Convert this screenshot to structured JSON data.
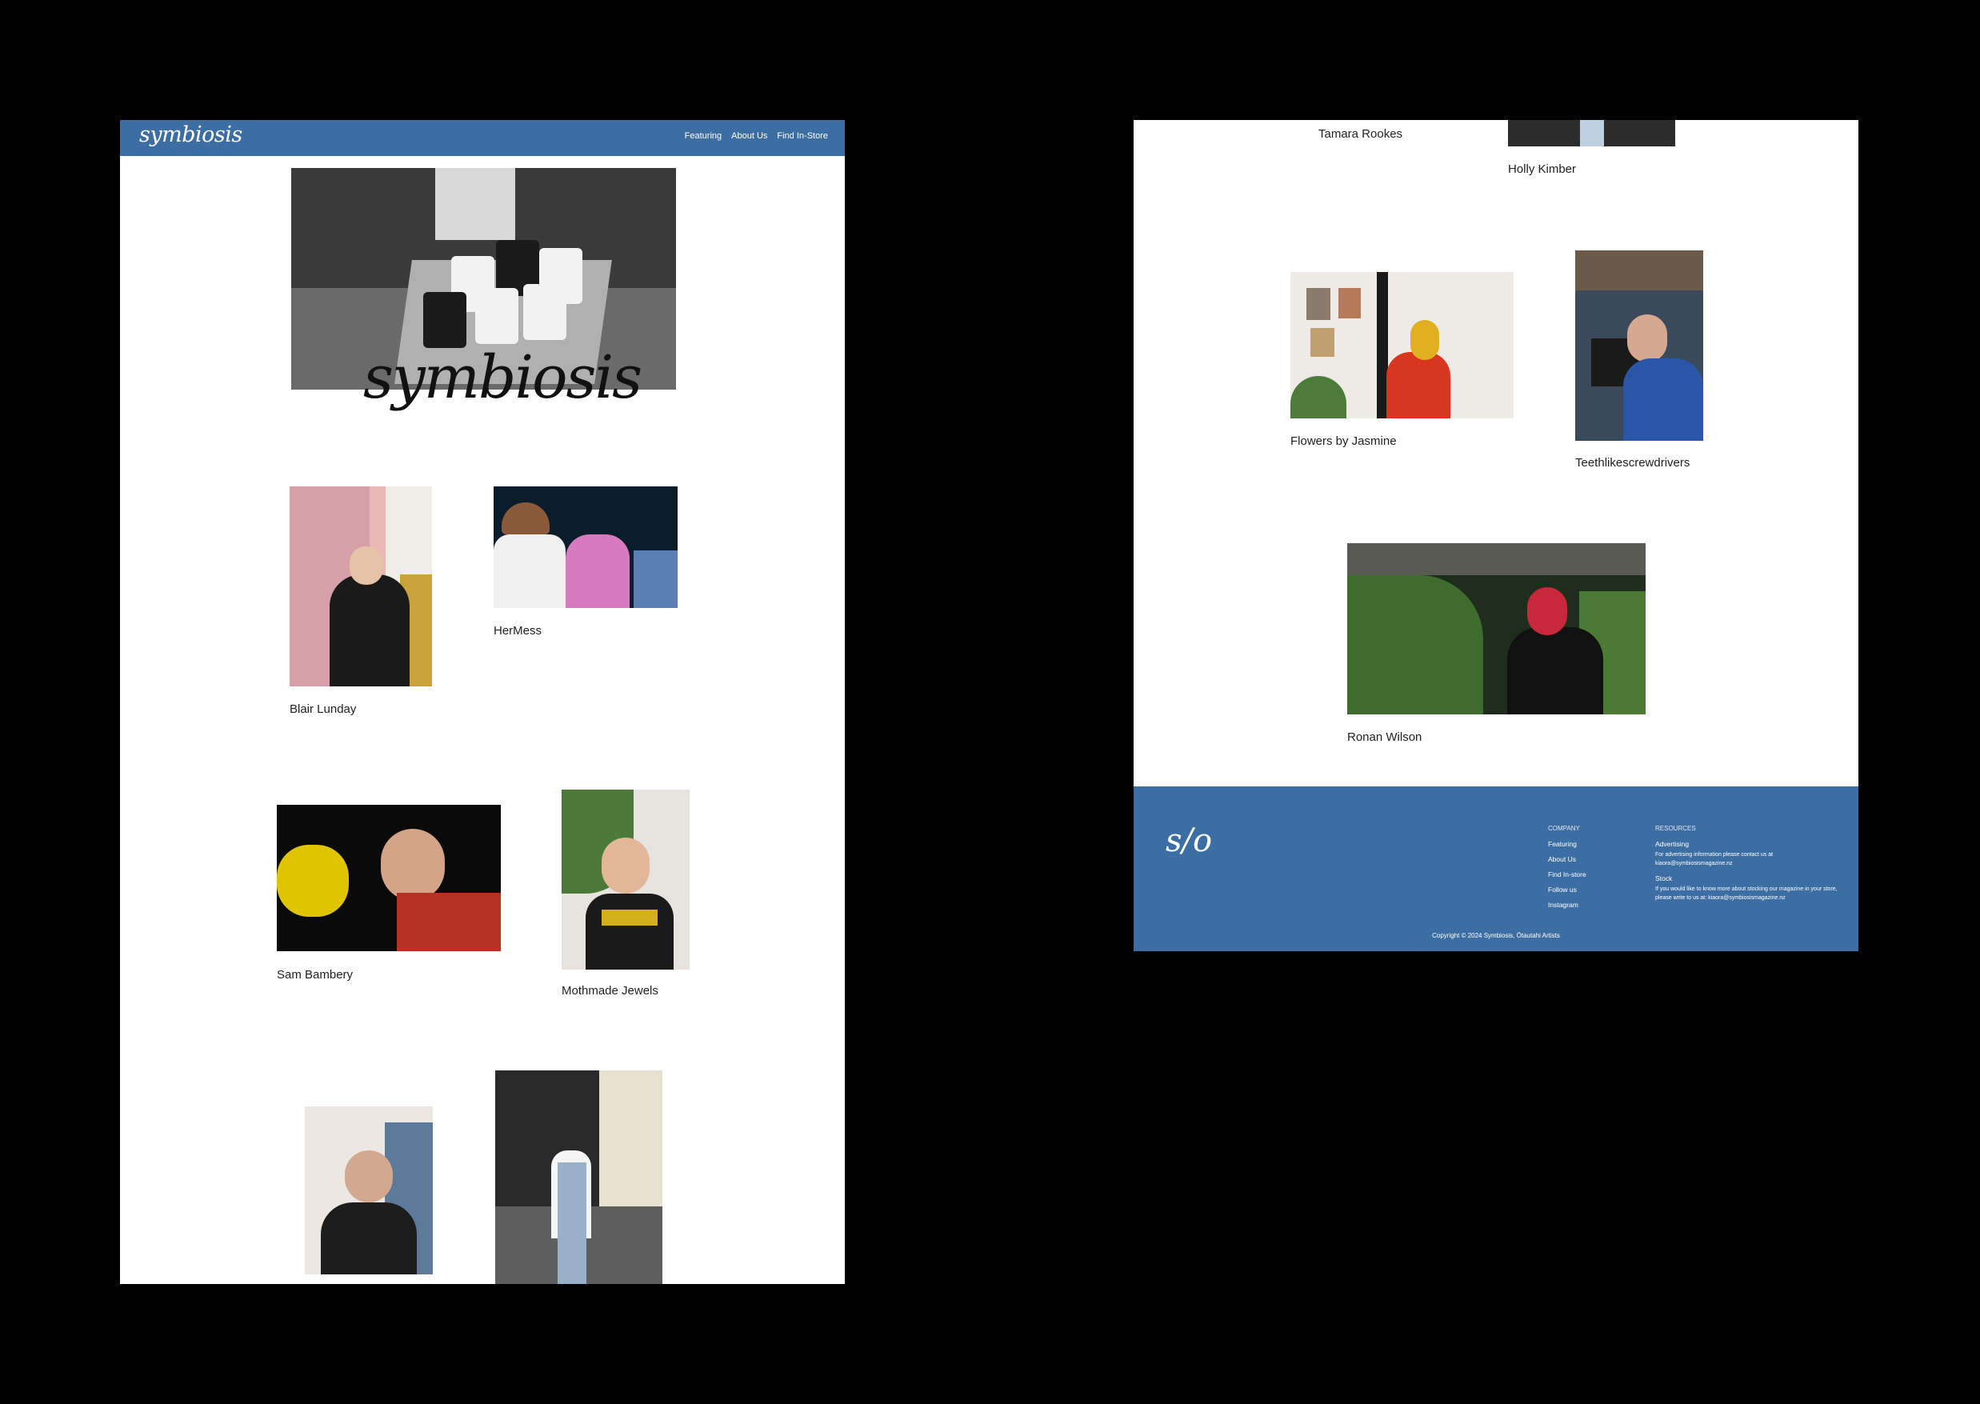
{
  "left_panel": {
    "nav": {
      "logo": "symbiosis",
      "links": [
        "Featuring",
        "About Us",
        "Find In-Store"
      ]
    },
    "hero": {
      "title": "symbiosis"
    },
    "artists": [
      "Blair Lunday",
      "HerMess",
      "Sam Bambery",
      "Mothmade Jewels"
    ]
  },
  "right_panel": {
    "artists": [
      "Tamara Rookes",
      "Holly Kimber",
      "Flowers by Jasmine",
      "Teethlikescrewdrivers",
      "Ronan Wilson"
    ],
    "footer": {
      "logo": "s/o",
      "company_heading": "COMPANY",
      "company_links": [
        "Featuring",
        "About Us",
        "Find In-store",
        "Follow us",
        "Instagram"
      ],
      "resources_heading": "RESOURCES",
      "advertising_label": "Advertising",
      "advertising_note": "For advertising information please contact us at kiaora@symbiosismagazine.nz",
      "stock_label": "Stock",
      "stock_note": "If you would like to know more about stocking our magazine in your store, please write to us at: kiaora@symbiosismagazine.nz",
      "copyright": "Copyright © 2024 Symbiosis, Ōtautahi Artists"
    }
  },
  "colors": {
    "brand_blue": "#3c6ea4",
    "background": "#000000",
    "panel": "#ffffff"
  }
}
